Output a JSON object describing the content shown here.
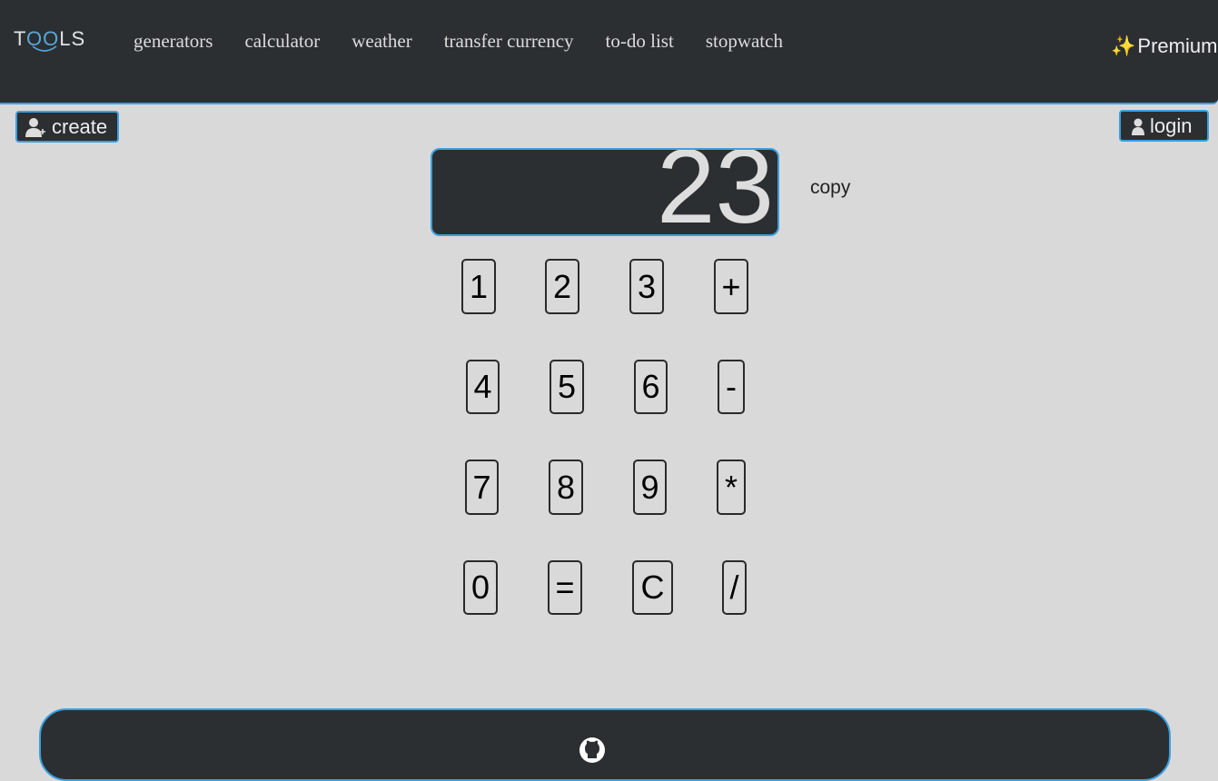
{
  "header": {
    "logo": {
      "t": "T",
      "o1": "O",
      "o2": "O",
      "rest": "LS"
    },
    "nav": [
      "generators",
      "calculator",
      "weather",
      "transfer currency",
      "to-do list",
      "stopwatch"
    ],
    "premium": {
      "icon": "sparkles-icon",
      "label": "Premium"
    }
  },
  "account": {
    "create_label": "create",
    "login_label": "login"
  },
  "calculator": {
    "display": "23",
    "copy_label": "copy",
    "keys": [
      [
        "1",
        "2",
        "3",
        "+"
      ],
      [
        "4",
        "5",
        "6",
        "-"
      ],
      [
        "7",
        "8",
        "9",
        "*"
      ],
      [
        "0",
        "=",
        "C",
        "/"
      ]
    ]
  },
  "footer": {
    "icon": "github-icon"
  },
  "colors": {
    "bar": "#2b2f32",
    "accent": "#3ba0e0",
    "background": "#d9d9d9"
  }
}
